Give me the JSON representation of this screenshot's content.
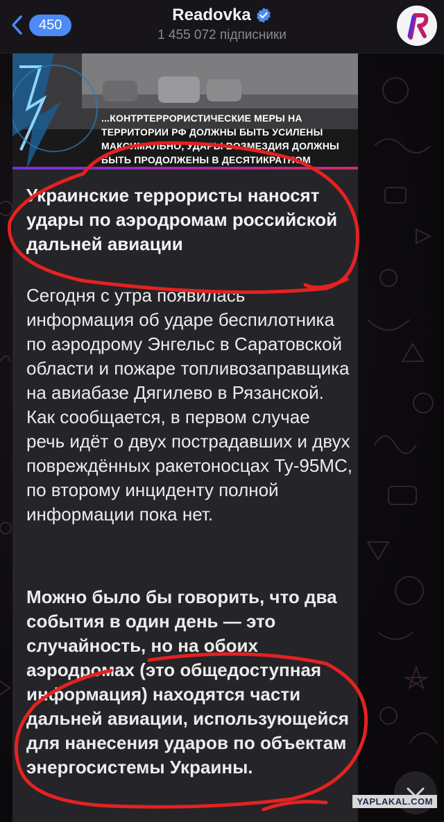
{
  "header": {
    "back_count": "450",
    "channel_name": "Readovka",
    "subscribers": "1 455 072 підписники",
    "verified_icon": "verified-badge-icon",
    "avatar_icon": "readovka-logo-icon",
    "accent_color": "#4c8bf5"
  },
  "post": {
    "media_caption": "...КОНТРТЕРРОРИСТИЧЕСКИЕ МЕРЫ НА ТЕРРИТОРИИ РФ ДОЛЖНЫ БЫТЬ УСИЛЕНЫ МАКСИМАЛЬНО, УДАРЫ ВОЗМЕЗДИЯ ДОЛЖНЫ БЫТЬ ПРОДОЛЖЕНЫ В ДЕСЯТИКРАТНОМ РАЗМЕРЕ...",
    "headline": "Украинские террористы наносят удары по аэродромам российской дальней авиации",
    "paragraph1": "Сегодня с утра появилась информация об ударе беспилотника по аэродрому Энгельс в Саратовской области и пожаре топливозаправщика на авиабазе Дягилево в Рязанской. Как сообщается, в первом случае речь идёт о двух пострадавших и двух повреждённых ракетоносцах Ту-95МС, по второму инциденту полной информации пока нет.",
    "paragraph2": "Можно было бы говорить, что два события в один день — это случайность, но на обоих аэродромах (это общедоступная информация) находятся части дальней авиации, использующейся для нанесения ударов по объектам энергосистемы Украины."
  },
  "scroll_icon": "chevron-down-icon",
  "watermark": "YAPLAKAL.COM",
  "annotation_color": "#e32222"
}
